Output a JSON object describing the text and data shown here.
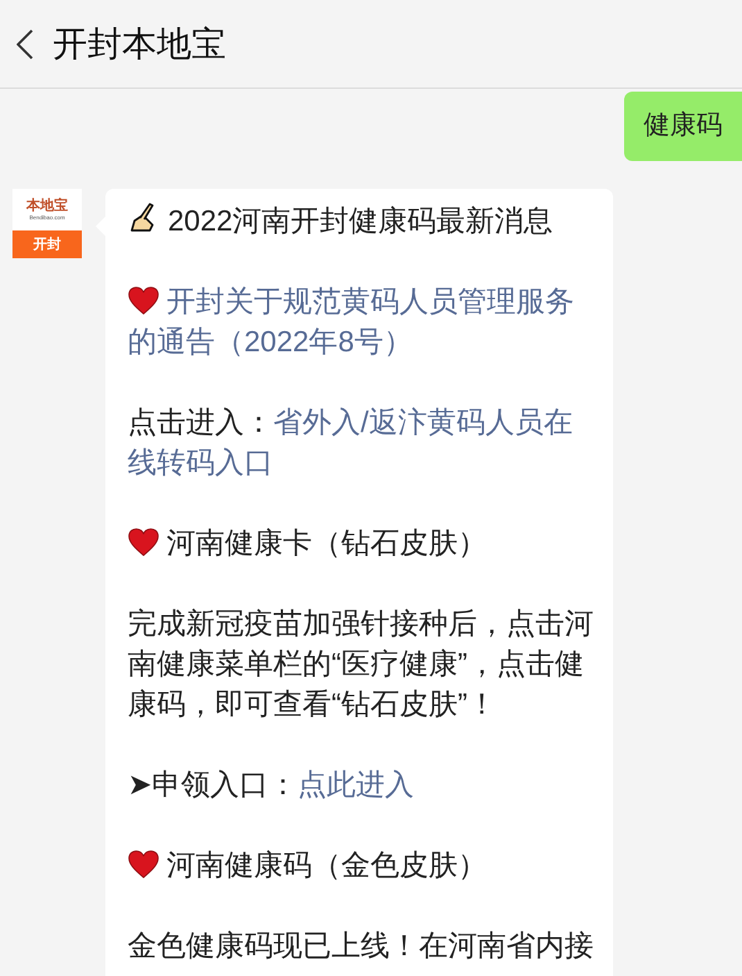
{
  "header": {
    "title": "开封本地宝"
  },
  "messages": [
    {
      "kind": "sent",
      "text": "健康码"
    },
    {
      "kind": "received",
      "avatar": {
        "brand": "本地宝",
        "site": "Bendibao.com",
        "city": "开封"
      },
      "paragraphs": [
        {
          "kind": "hand-heading",
          "text": "2022河南开封健康码最新消息"
        },
        {
          "kind": "heart-link",
          "link": "开封关于规范黄码人员管理服务的通告（2022年8号）"
        },
        {
          "kind": "wrapped-link",
          "text": "点击进入：",
          "link": "省外入/返汴黄码人员在线转码入口"
        },
        {
          "kind": "heart-heading",
          "text": "河南健康卡（钻石皮肤）"
        },
        {
          "kind": "plain",
          "text": "完成新冠疫苗加强针接种后，点击河南健康菜单栏的“医疗健康”，点击健康码，即可查看“钻石皮肤”！"
        },
        {
          "kind": "short-link",
          "text": "➤申领入口：",
          "link": "点此进入"
        },
        {
          "kind": "heart-heading",
          "text": "河南健康码（金色皮肤）"
        },
        {
          "kind": "plain",
          "text": "金色健康码现已上线！在河南省内接"
        }
      ]
    }
  ]
}
